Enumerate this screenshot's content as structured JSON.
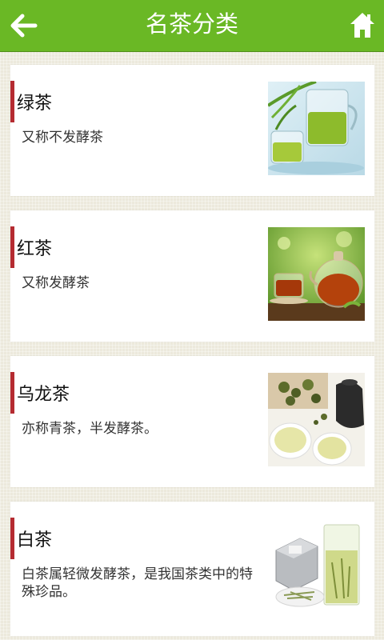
{
  "header": {
    "title": "名茶分类",
    "back_icon": "arrow-left-icon",
    "home_icon": "home-icon"
  },
  "colors": {
    "header_bg": "#6ab825",
    "accent_bar": "#b52b31"
  },
  "categories": [
    {
      "name": "绿茶",
      "desc": "又称不发酵茶",
      "image": "green-tea-image"
    },
    {
      "name": "红茶",
      "desc": "又称发酵茶",
      "image": "black-tea-image"
    },
    {
      "name": "乌龙茶",
      "desc": "亦称青茶，半发酵茶。",
      "image": "oolong-tea-image"
    },
    {
      "name": "白茶",
      "desc": "白茶属轻微发酵茶，是我国茶类中的特殊珍品。",
      "image": "white-tea-image"
    }
  ]
}
